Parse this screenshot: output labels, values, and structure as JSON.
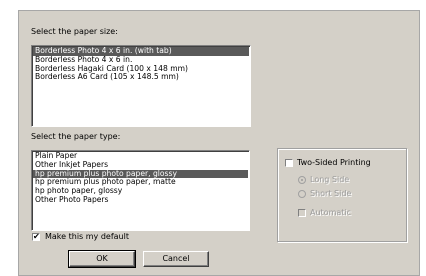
{
  "size": {
    "label": "Select the paper size:",
    "items": [
      "Borderless Photo 4 x 6 in. (with tab)",
      "Borderless Photo 4 x 6 in.",
      "Borderless Hagaki Card (100 x 148 mm)",
      "Borderless A6 Card (105 x 148.5 mm)"
    ],
    "selected_index": 0
  },
  "type": {
    "label": "Select the paper type:",
    "items": [
      "Plain Paper",
      "Other Inkjet Papers",
      "hp premium plus photo paper, glossy",
      "hp premium plus photo paper, matte",
      "hp photo paper, glossy",
      "Other Photo Papers"
    ],
    "selected_index": 2
  },
  "duplex": {
    "label": "Two-Sided Printing",
    "checked": false,
    "long_side": "Long Side",
    "short_side": "Short Side",
    "automatic": "Automatic"
  },
  "default_checkbox": {
    "label": "Make this my default",
    "checked": true
  },
  "buttons": {
    "ok": "OK",
    "cancel": "Cancel"
  },
  "colors": {
    "dialog_bg": "#d4d0c8",
    "selection_bg": "#5a5a5a"
  }
}
